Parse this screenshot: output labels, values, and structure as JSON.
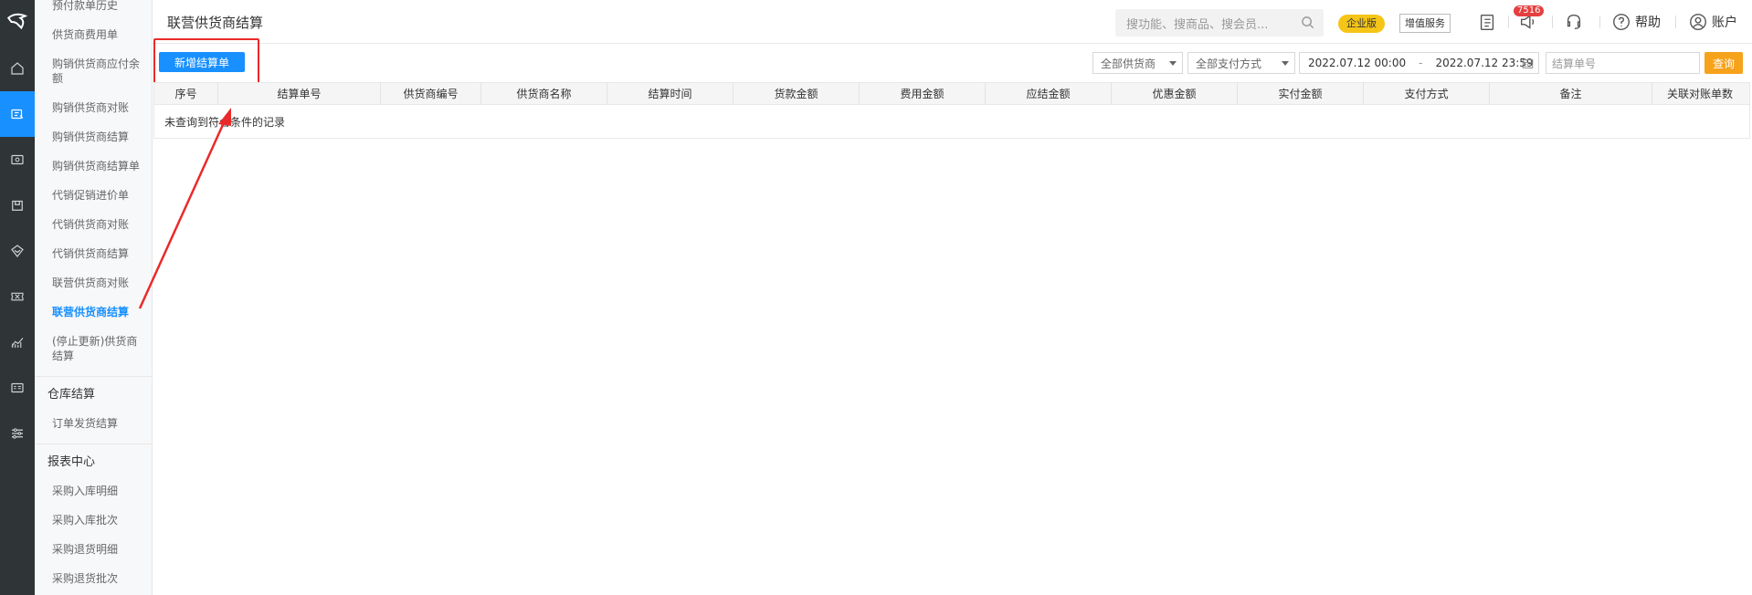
{
  "rail": {
    "items": [
      {
        "icon": "home-icon"
      },
      {
        "icon": "finance-icon",
        "active": true
      },
      {
        "icon": "money-icon"
      },
      {
        "icon": "product-icon"
      },
      {
        "icon": "promotion-icon"
      },
      {
        "icon": "ticket-icon"
      },
      {
        "icon": "report-chart-icon"
      },
      {
        "icon": "card-icon"
      },
      {
        "icon": "settings-icon"
      }
    ]
  },
  "submenu": {
    "items_top": [
      "预付款单历史",
      "供货商费用单",
      "购销供货商应付余额",
      "购销供货商对账",
      "购销供货商结算",
      "购销供货商结算单",
      "代销促销进价单",
      "代销供货商对账",
      "代销供货商结算",
      "联营供货商对账",
      "联营供货商结算",
      "(停止更新)供货商结算"
    ],
    "group_warehouse": "仓库结算",
    "warehouse_items": [
      "订单发货结算"
    ],
    "group_report": "报表中心",
    "report_items": [
      "采购入库明细",
      "采购入库批次",
      "采购退货明细",
      "采购退货批次"
    ]
  },
  "header": {
    "title": "联营供货商结算",
    "search_placeholder": "搜功能、搜商品、搜会员...",
    "edition_badge": "企业版",
    "value_added_label": "增值服务",
    "message_count": "7516",
    "help_label": "帮助",
    "account_label": "账户"
  },
  "toolbar": {
    "new_button": "新增结算单",
    "supplier_select": "全部供货商",
    "payment_select": "全部支付方式",
    "date_start": "2022.07.12 00:00",
    "date_sep": "-",
    "date_end": "2022.07.12 23:59",
    "order_placeholder": "结算单号",
    "query_button": "查询"
  },
  "table": {
    "columns": [
      "序号",
      "结算单号",
      "供货商编号",
      "供货商名称",
      "结算时间",
      "货款金额",
      "费用金额",
      "应结金额",
      "优惠金额",
      "实付金额",
      "支付方式",
      "备注",
      "关联对账单数"
    ],
    "empty_text": "未查询到符合条件的记录"
  },
  "colors": {
    "primary": "#1890ff",
    "query": "#f7a21b",
    "annotation": "#ea2a2a",
    "rail_bg": "#2f3437"
  }
}
